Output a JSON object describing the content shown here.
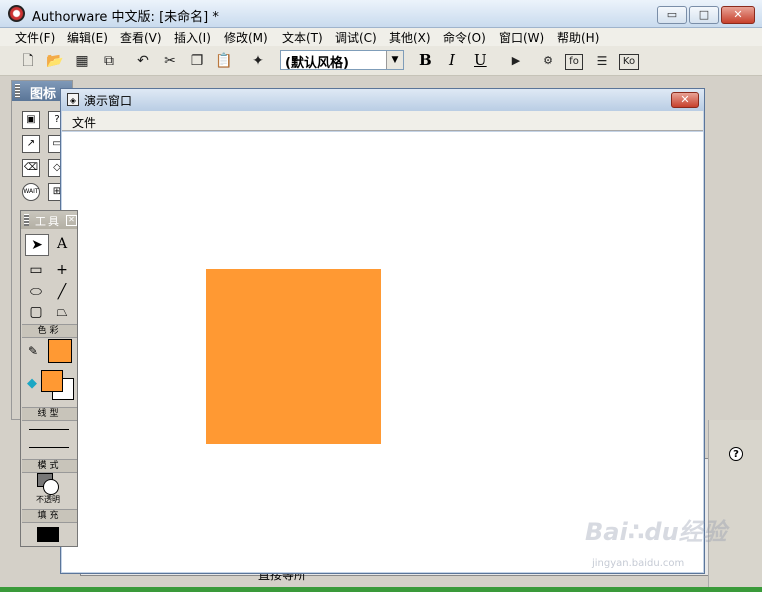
{
  "window": {
    "title": "Authorware 中文版: [未命名] *",
    "minimize_glyph": "▭",
    "maximize_glyph": "□",
    "close_glyph": "✕"
  },
  "menubar": {
    "items": [
      "文件(F)",
      "编辑(E)",
      "查看(V)",
      "插入(I)",
      "修改(M)",
      "文本(T)",
      "调试(C)",
      "其他(X)",
      "命令(O)",
      "窗口(W)",
      "帮助(H)"
    ]
  },
  "toolbar": {
    "style_value": "(默认风格)",
    "bold_label": "B",
    "italic_label": "I",
    "underline_label": "U",
    "fo_label": "fo",
    "ko_label": "Ko"
  },
  "icons_panel": {
    "title": "图标"
  },
  "presentation_window": {
    "title": "演示窗口",
    "menu_file": "文件",
    "close_glyph": "✕",
    "shape_color": "#FF9933"
  },
  "tools_palette": {
    "title": "工具",
    "close_glyph": "✕",
    "text_tool": "A",
    "section_color": "色彩",
    "section_line": "线型",
    "section_mode": "模式",
    "section_fill": "填充",
    "mode_value": "不透明",
    "stroke_color": "#FF9933",
    "fill_color": "#FF9933",
    "fill_pattern_color": "#000000"
  },
  "bottom": {
    "label": "直接等所",
    "help_glyph": "?"
  },
  "watermark": {
    "text": "Baidu经验",
    "url": "jingyan.baidu.com"
  }
}
